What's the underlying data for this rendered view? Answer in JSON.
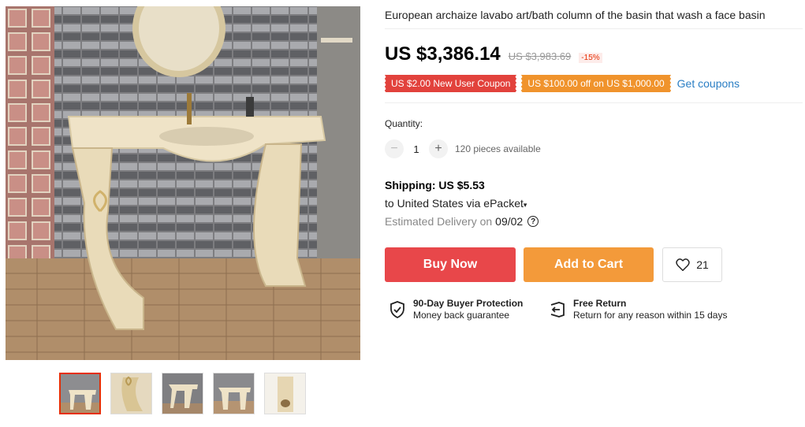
{
  "product": {
    "title": "European archaize lavabo art/bath column of the basin that wash a face basin",
    "price": "US $3,386.14",
    "original_price": "US $3,983.69",
    "discount": "-15%"
  },
  "coupons": {
    "items": [
      {
        "label": "US $2.00 New User Coupon",
        "color": "#e2423c"
      },
      {
        "label": "US $100.00 off on US $1,000.00",
        "color": "#f0932c"
      }
    ],
    "get_label": "Get coupons"
  },
  "quantity": {
    "label": "Quantity:",
    "value": "1",
    "minus": "−",
    "plus": "+",
    "available": "120 pieces available"
  },
  "shipping": {
    "title": "Shipping: US $5.53",
    "to": "to United States via ePacket",
    "estimated_prefix": "Estimated Delivery on",
    "estimated_date": "09/02",
    "help_icon": "?"
  },
  "actions": {
    "buy_now": "Buy Now",
    "add_to_cart": "Add to Cart",
    "wishlist_count": "21"
  },
  "guarantees": [
    {
      "icon": "shield-check-icon",
      "title": "90-Day Buyer Protection",
      "subtitle": "Money back guarantee"
    },
    {
      "icon": "return-icon",
      "title": "Free Return",
      "subtitle": "Return for any reason within 15 days"
    }
  ],
  "gallery": {
    "thumbnail_count": 5,
    "active_index": 0
  },
  "colors": {
    "buy_now": "#e8474a",
    "add_to_cart": "#f39a3a",
    "link": "#2a7ec4",
    "discount": "#e62e04"
  }
}
